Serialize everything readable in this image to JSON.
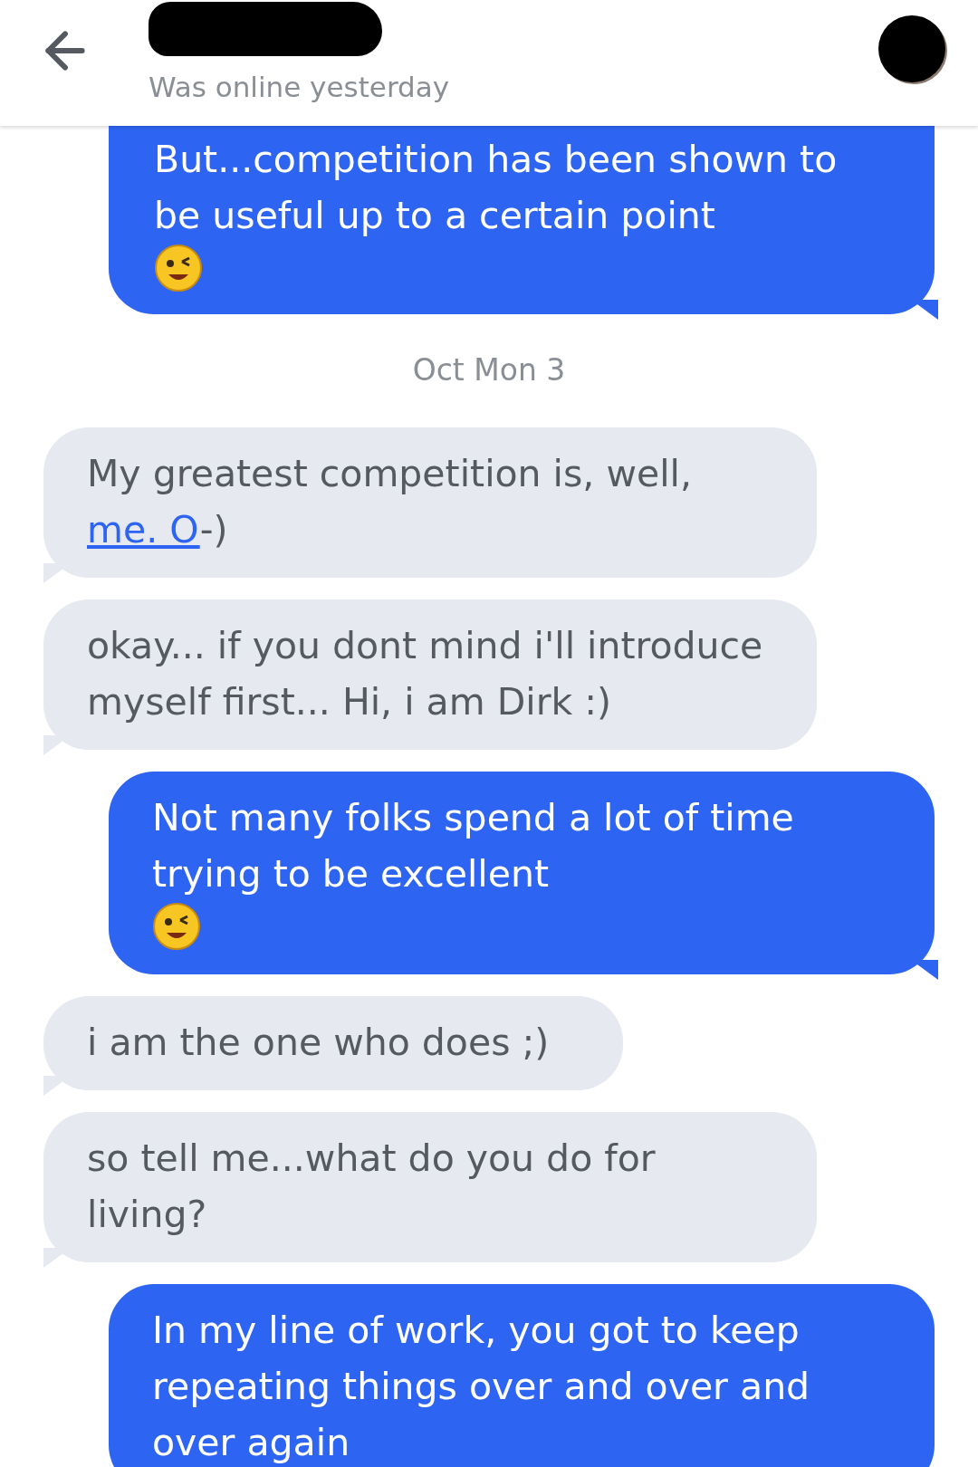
{
  "header": {
    "status": "Was online yesterday"
  },
  "messages": [
    {
      "kind": "sent",
      "parts": [
        {
          "kind": "text",
          "text": "But...competition has been shown to be useful up to a certain point "
        },
        {
          "kind": "emoji"
        }
      ]
    },
    {
      "kind": "date",
      "text": "Oct Mon 3"
    },
    {
      "kind": "received",
      "parts": [
        {
          "kind": "text",
          "text": "My greatest competition is, well, "
        },
        {
          "kind": "link",
          "text": "me. O"
        },
        {
          "kind": "text",
          "text": "-)"
        }
      ]
    },
    {
      "kind": "received",
      "parts": [
        {
          "kind": "text",
          "text": "okay... if you dont mind i'll introduce myself first... Hi, i am Dirk :)"
        }
      ]
    },
    {
      "kind": "sent",
      "parts": [
        {
          "kind": "text",
          "text": "Not many folks spend a lot of time trying to be excellent "
        },
        {
          "kind": "emoji"
        }
      ]
    },
    {
      "kind": "received",
      "parts": [
        {
          "kind": "text",
          "text": "i am the one who does ;)"
        }
      ]
    },
    {
      "kind": "received",
      "parts": [
        {
          "kind": "text",
          "text": "so tell me...what do you do for living?"
        }
      ]
    },
    {
      "kind": "sent",
      "parts": [
        {
          "kind": "text",
          "text": "In my line of work, you got to keep repeating things over and over and over again"
        }
      ]
    }
  ]
}
